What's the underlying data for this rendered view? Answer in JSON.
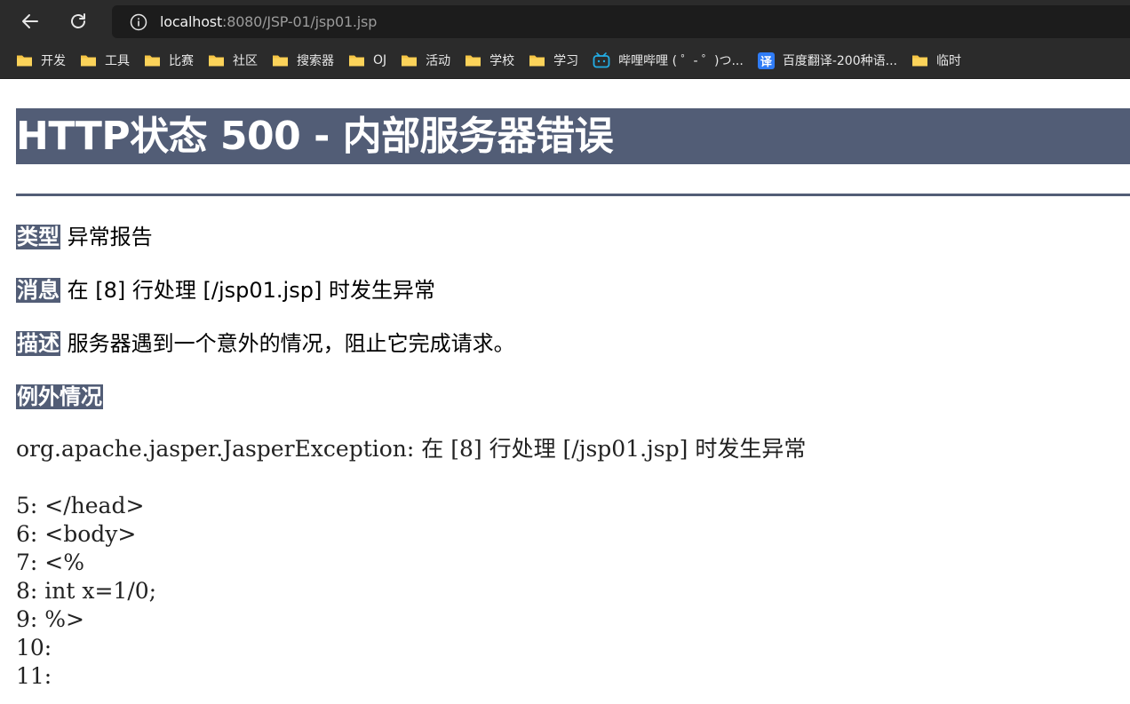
{
  "browser": {
    "url_host": "localhost",
    "url_path": ":8080/JSP-01/jsp01.jsp",
    "bookmarks": [
      {
        "label": "开发",
        "icon": "folder-icon"
      },
      {
        "label": "工具",
        "icon": "folder-icon"
      },
      {
        "label": "比赛",
        "icon": "folder-icon"
      },
      {
        "label": "社区",
        "icon": "folder-icon"
      },
      {
        "label": "搜索器",
        "icon": "folder-icon"
      },
      {
        "label": "OJ",
        "icon": "folder-icon"
      },
      {
        "label": "活动",
        "icon": "folder-icon"
      },
      {
        "label": "学校",
        "icon": "folder-icon"
      },
      {
        "label": "学习",
        "icon": "folder-icon"
      },
      {
        "label": "哔哩哔哩 ( ゜- ゜)つ...",
        "icon": "bilibili-icon"
      },
      {
        "label": "百度翻译-200种语...",
        "icon": "translate-icon"
      },
      {
        "label": "临时",
        "icon": "folder-icon"
      }
    ],
    "translate_icon_text": "译"
  },
  "error": {
    "title": "HTTP状态 500 - 内部服务器错误",
    "type_label": "类型",
    "type_value": "异常报告",
    "message_label": "消息",
    "message_value": "在 [8] 行处理 [/jsp01.jsp] 时发生异常",
    "description_label": "描述",
    "description_value": "服务器遇到一个意外的情况，阻止它完成请求。",
    "exception_label": "例外情况",
    "exception_line": "org.apache.jasper.JasperException: 在 [8] 行处理 [/jsp01.jsp] 时发生异常",
    "source_lines": [
      "5: </head>",
      "6: <body>",
      "7: <%",
      "8: int x=1/0;",
      "9: %>",
      "10:",
      "11:"
    ]
  },
  "colors": {
    "tomcat_header": "#525d76",
    "chrome_bg": "#2b2b2b",
    "folder": "#f6c444"
  }
}
